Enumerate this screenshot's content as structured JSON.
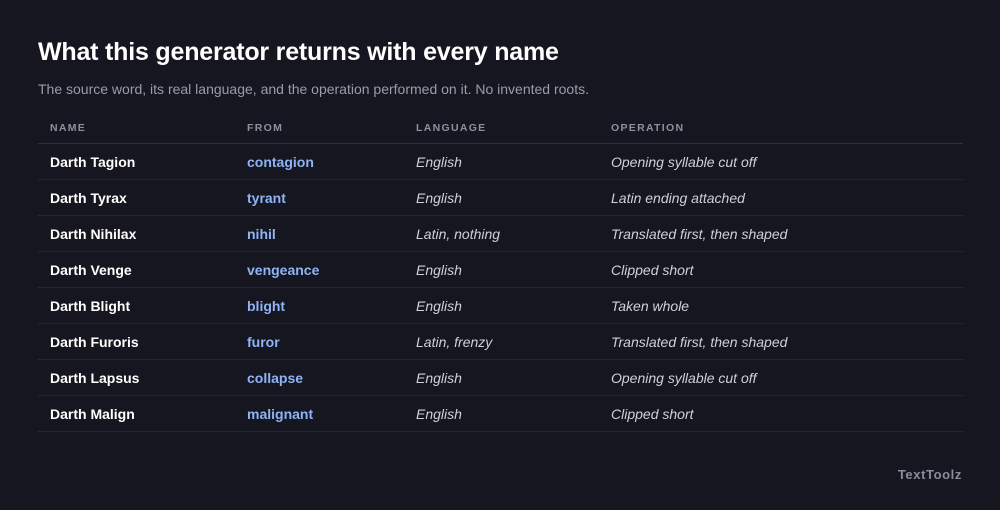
{
  "header": {
    "title": "What this generator returns with every name",
    "subtitle": "The source word, its real language, and the operation performed on it. No invented roots."
  },
  "table": {
    "columns": [
      "NAME",
      "FROM",
      "LANGUAGE",
      "OPERATION"
    ],
    "rows": [
      {
        "name": "Darth Tagion",
        "from": "contagion",
        "language": "English",
        "operation": "Opening syllable cut off"
      },
      {
        "name": "Darth Tyrax",
        "from": "tyrant",
        "language": "English",
        "operation": "Latin ending attached"
      },
      {
        "name": "Darth Nihilax",
        "from": "nihil",
        "language": "Latin, nothing",
        "operation": "Translated first, then shaped"
      },
      {
        "name": "Darth Venge",
        "from": "vengeance",
        "language": "English",
        "operation": "Clipped short"
      },
      {
        "name": "Darth Blight",
        "from": "blight",
        "language": "English",
        "operation": "Taken whole"
      },
      {
        "name": "Darth Furoris",
        "from": "furor",
        "language": "Latin, frenzy",
        "operation": "Translated first, then shaped"
      },
      {
        "name": "Darth Lapsus",
        "from": "collapse",
        "language": "English",
        "operation": "Opening syllable cut off"
      },
      {
        "name": "Darth Malign",
        "from": "malignant",
        "language": "English",
        "operation": "Clipped short"
      }
    ]
  },
  "footer": {
    "brand": "TextToolz"
  },
  "colors": {
    "background": "#15161f",
    "accent_link": "#8fb4f6",
    "header_text": "#8e90a0",
    "muted_text": "#9a9cab"
  }
}
